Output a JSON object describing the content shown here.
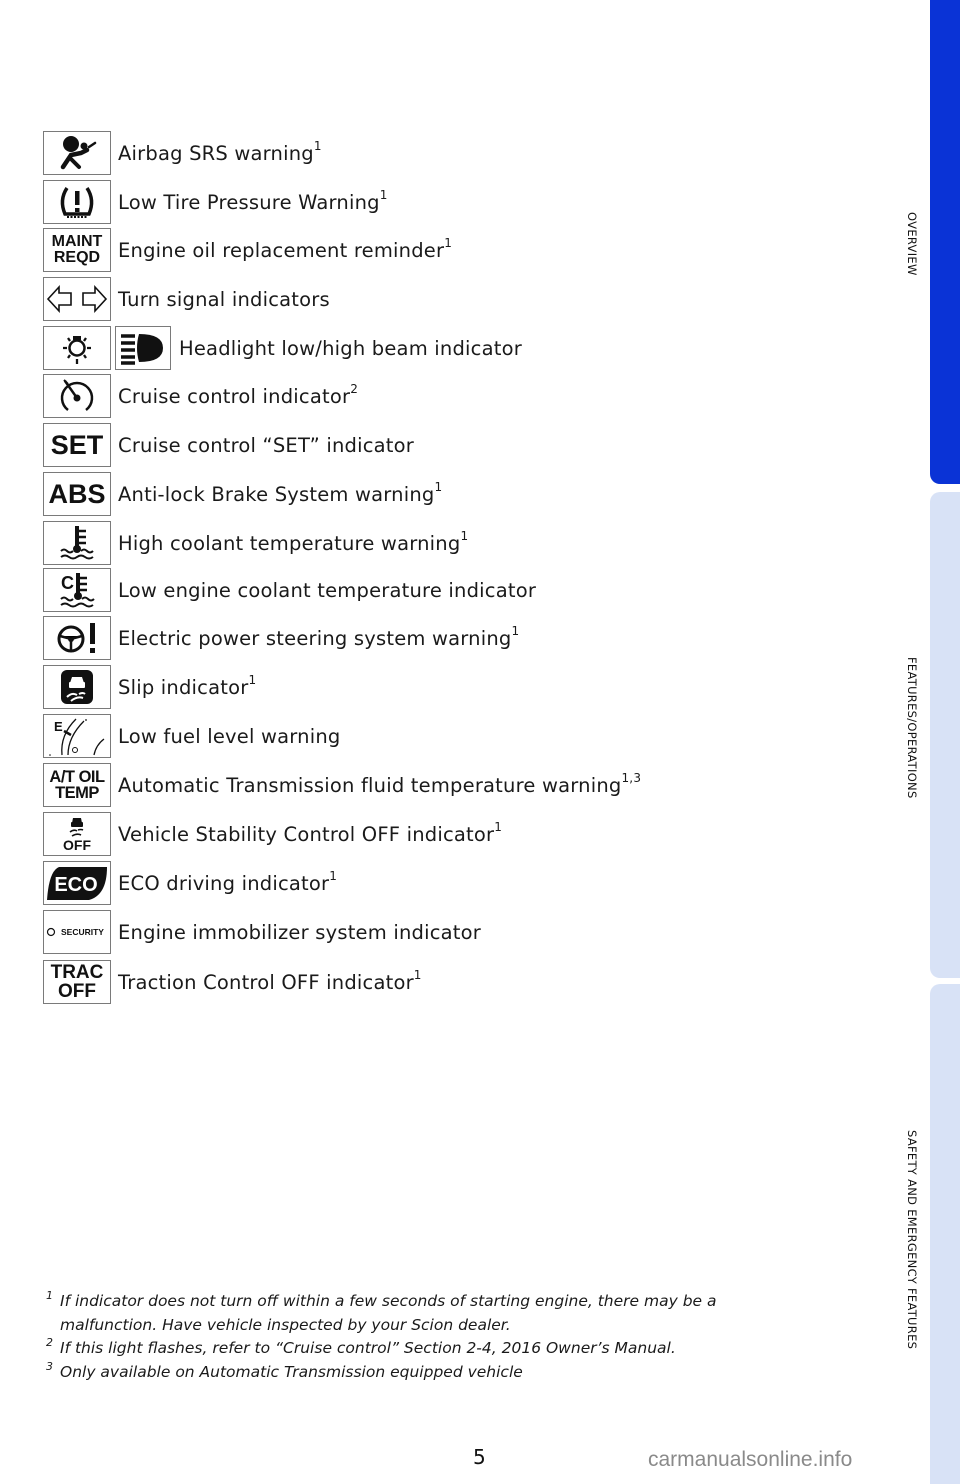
{
  "indicators": [
    {
      "icon": "airbag-srs-icon",
      "label": "Airbag SRS warning",
      "note": "1"
    },
    {
      "icon": "tire-pressure-icon",
      "label": "Low Tire Pressure Warning",
      "note": "1"
    },
    {
      "icon": "maint-reqd-icon",
      "icon_text": [
        "MAINT",
        "REQD"
      ],
      "label": "Engine oil replacement reminder",
      "note": "1"
    },
    {
      "icon": "turn-signal-icon",
      "label": "Turn signal indicators",
      "note": ""
    },
    {
      "icon": "headlight-low-beam-icon",
      "icon2": "headlight-high-beam-icon",
      "label": "Headlight low/high beam indicator",
      "note": ""
    },
    {
      "icon": "cruise-control-icon",
      "label": "Cruise control indicator",
      "note": "2"
    },
    {
      "icon": "cruise-set-icon",
      "icon_text": [
        "SET"
      ],
      "label": "Cruise control “SET” indicator",
      "note": ""
    },
    {
      "icon": "abs-icon",
      "icon_text": [
        "ABS"
      ],
      "label": "Anti-lock Brake System warning",
      "note": "1"
    },
    {
      "icon": "high-coolant-temp-icon",
      "label": "High coolant temperature warning",
      "note": "1"
    },
    {
      "icon": "low-coolant-temp-icon",
      "icon_text": [
        "C"
      ],
      "label": "Low engine coolant temperature indicator",
      "note": ""
    },
    {
      "icon": "power-steering-icon",
      "label": "Electric power steering system warning",
      "note": "1"
    },
    {
      "icon": "slip-icon",
      "label": "Slip indicator",
      "note": "1"
    },
    {
      "icon": "low-fuel-icon",
      "icon_text": [
        "E"
      ],
      "label": "Low fuel level warning",
      "note": ""
    },
    {
      "icon": "at-oil-temp-icon",
      "icon_text": [
        "A/T OIL",
        "TEMP"
      ],
      "label": "Automatic Transmission fluid temperature warning",
      "note": "1,3"
    },
    {
      "icon": "vsc-off-icon",
      "icon_text": [
        "OFF"
      ],
      "label": "Vehicle Stability Control OFF indicator",
      "note": "1"
    },
    {
      "icon": "eco-icon",
      "icon_text": [
        "ECO"
      ],
      "label": "ECO driving indicator",
      "note": "1"
    },
    {
      "icon": "security-icon",
      "icon_text": [
        "SECURITY"
      ],
      "label": "Engine immobilizer system indicator",
      "note": ""
    },
    {
      "icon": "trac-off-icon",
      "icon_text": [
        "TRAC",
        "OFF"
      ],
      "label": "Traction Control OFF indicator",
      "note": "1"
    }
  ],
  "footnotes": [
    {
      "mark": "1",
      "lines": [
        "If indicator does not turn off within a few seconds of starting engine, there may be a",
        "malfunction. Have vehicle inspected by your Scion dealer."
      ]
    },
    {
      "mark": "2",
      "lines": [
        "If this light flashes, refer to “Cruise control” Section 2-4, 2016 Owner’s Manual."
      ]
    },
    {
      "mark": "3",
      "lines": [
        "Only available on Automatic Transmission equipped vehicle"
      ]
    }
  ],
  "side_tabs": [
    {
      "label": "OVERVIEW",
      "active": true
    },
    {
      "label": "FEATURES/OPERATIONS",
      "active": false
    },
    {
      "label": "SAFETY AND EMERGENCY FEATURES",
      "active": false
    }
  ],
  "colors": {
    "active_tab": "#0a33d6",
    "inactive_tab": "#d8e2f6"
  },
  "page_number": "5",
  "watermark": "carmanualsonline.info"
}
